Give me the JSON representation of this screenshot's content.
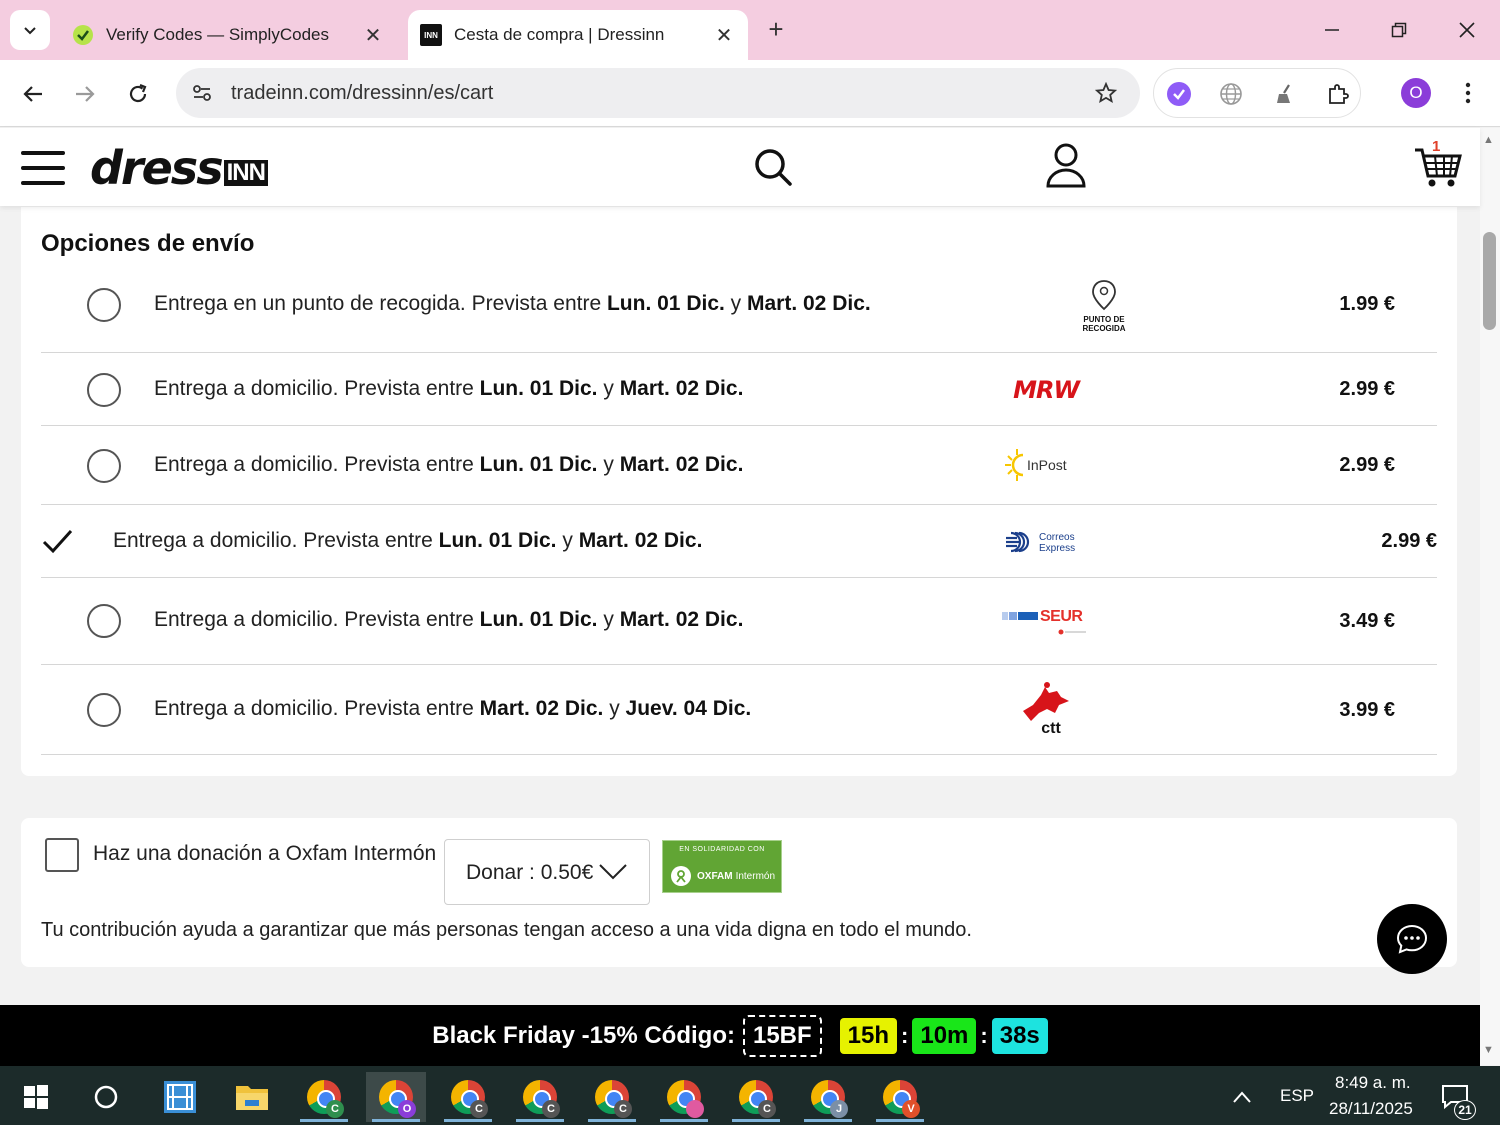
{
  "browser": {
    "tabs": [
      {
        "title": "Verify Codes — SimplyCodes",
        "favicon": "simplycodes-icon"
      },
      {
        "title": "Cesta de compra | Dressinn",
        "favicon": "inn-icon"
      }
    ],
    "url": "tradeinn.com/dressinn/es/cart",
    "profile_initial": "O"
  },
  "site": {
    "logo_main": "dress",
    "logo_suffix": "INN",
    "cart_count": "1"
  },
  "shipping": {
    "title": "Opciones de envío",
    "options": [
      {
        "prefix": "Entrega en un punto de recogida. Prevista entre ",
        "from": "Lun. 01 Dic.",
        "mid": " y ",
        "to": "Mart. 02 Dic.",
        "carrier": "PUNTO DE RECOGIDA",
        "price": "1.99 €",
        "selected": false
      },
      {
        "prefix": "Entrega a domicilio. Prevista entre ",
        "from": "Lun. 01 Dic.",
        "mid": " y ",
        "to": "Mart. 02 Dic.",
        "carrier": "MRW",
        "price": "2.99 €",
        "selected": false
      },
      {
        "prefix": "Entrega a domicilio. Prevista entre ",
        "from": "Lun. 01 Dic.",
        "mid": " y ",
        "to": "Mart. 02 Dic.",
        "carrier": "InPost",
        "price": "2.99 €",
        "selected": false
      },
      {
        "prefix": "Entrega a domicilio. Prevista entre ",
        "from": "Lun. 01 Dic.",
        "mid": " y ",
        "to": "Mart. 02 Dic.",
        "carrier": "Correos Express",
        "price": "2.99 €",
        "selected": true
      },
      {
        "prefix": "Entrega a domicilio. Prevista entre ",
        "from": "Lun. 01 Dic.",
        "mid": " y ",
        "to": "Mart. 02 Dic.",
        "carrier": "SEUR",
        "price": "3.49 €",
        "selected": false
      },
      {
        "prefix": "Entrega a domicilio. Prevista entre ",
        "from": "Mart. 02 Dic.",
        "mid": " y ",
        "to": "Juev. 04 Dic.",
        "carrier": "ctt",
        "price": "3.99 €",
        "selected": false
      }
    ]
  },
  "donation": {
    "label": "Haz una donación a Oxfam Intermón",
    "select_value": "Donar : 0.50€",
    "badge_top": "EN SOLIDARIDAD CON",
    "badge_brand": "OXFAM",
    "badge_sub": "Intermón",
    "description": "Tu contribución ayuda a garantizar que más personas tengan acceso a una vida digna en todo el mundo."
  },
  "promo": {
    "text": "Black Friday -15% Código:",
    "code": "15BF",
    "hours": "15h",
    "minutes": "10m",
    "seconds": "38s",
    "separator": ":"
  },
  "taskbar": {
    "language": "ESP",
    "time": "8:49 a. m.",
    "date": "28/11/2025",
    "notifications": "21",
    "chrome_badges": [
      "C",
      "O",
      "C",
      "C",
      "C",
      "",
      "C",
      "J",
      "V"
    ]
  },
  "colors": {
    "tabstrip": "#f4cde0",
    "promo_bg": "#000000",
    "countdown_hours": "#e6f200",
    "countdown_minutes": "#19e619",
    "countdown_seconds": "#1de3df",
    "oxfam_green": "#61a534",
    "mrw_red": "#d7141a",
    "seur_blue": "#1b60b8",
    "seur_red": "#e4312b",
    "correos_blue": "#1b3f8b",
    "ctt_red": "#d7141a"
  }
}
